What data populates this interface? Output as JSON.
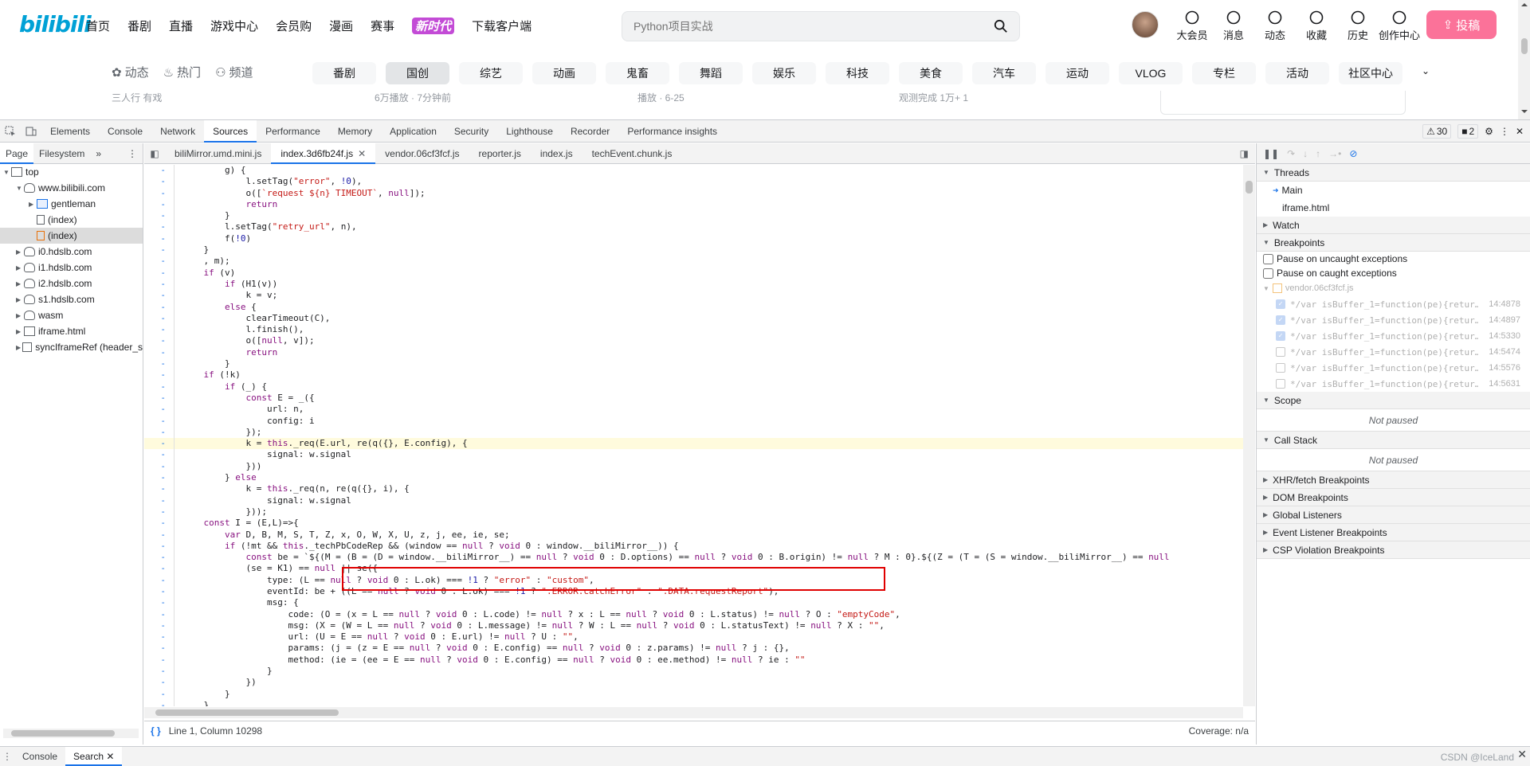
{
  "site": {
    "logo": "bilibili",
    "nav": [
      "首页",
      "番剧",
      "直播",
      "游戏中心",
      "会员购",
      "漫画",
      "赛事"
    ],
    "nav_badge": "新时代",
    "download": "下载客户端",
    "search_placeholder": "Python项目实战",
    "right_nav": [
      {
        "label": "大会员",
        "icon": "vip-icon"
      },
      {
        "label": "消息",
        "icon": "message-icon"
      },
      {
        "label": "动态",
        "icon": "dynamic-icon"
      },
      {
        "label": "收藏",
        "icon": "favorite-icon"
      },
      {
        "label": "历史",
        "icon": "history-icon"
      },
      {
        "label": "创作中心",
        "icon": "creator-icon"
      }
    ],
    "upload": "投稿",
    "channel_left": [
      "动态",
      "热门",
      "频道"
    ],
    "channels": [
      "番剧",
      "国创",
      "综艺",
      "动画",
      "鬼畜",
      "舞蹈",
      "娱乐",
      "科技",
      "美食",
      "汽车",
      "运动",
      "VLOG",
      "专栏",
      "活动",
      "社区中心"
    ],
    "active_channel": "国创",
    "peek_texts": [
      "三人行 有戏",
      "6万播放 · 7分钟前",
      "播放 · 6-25",
      "观测完成 1万+ 1"
    ]
  },
  "devtools": {
    "tabs": [
      "Elements",
      "Console",
      "Network",
      "Sources",
      "Performance",
      "Memory",
      "Application",
      "Security",
      "Lighthouse",
      "Recorder",
      "Performance insights"
    ],
    "active_tab": "Sources",
    "warnings": "30",
    "errors": "2",
    "navigator_tabs": [
      "Page",
      "Filesystem"
    ],
    "tree": [
      {
        "label": "top",
        "depth": 0,
        "kind": "frame",
        "open": true
      },
      {
        "label": "www.bilibili.com",
        "depth": 1,
        "kind": "cloud",
        "open": true
      },
      {
        "label": "gentleman",
        "depth": 2,
        "kind": "folder",
        "open": false
      },
      {
        "label": "(index)",
        "depth": 2,
        "kind": "file"
      },
      {
        "label": "(index)",
        "depth": 2,
        "kind": "file-orange",
        "selected": true
      },
      {
        "label": "i0.hdslb.com",
        "depth": 1,
        "kind": "cloud",
        "open": false
      },
      {
        "label": "i1.hdslb.com",
        "depth": 1,
        "kind": "cloud",
        "open": false
      },
      {
        "label": "i2.hdslb.com",
        "depth": 1,
        "kind": "cloud",
        "open": false
      },
      {
        "label": "s1.hdslb.com",
        "depth": 1,
        "kind": "cloud",
        "open": false
      },
      {
        "label": "wasm",
        "depth": 1,
        "kind": "cloud",
        "open": false
      },
      {
        "label": "iframe.html",
        "depth": 1,
        "kind": "frame",
        "open": false
      },
      {
        "label": "syncIframeRef (header_s",
        "depth": 1,
        "kind": "frame",
        "open": false
      }
    ],
    "file_tabs": [
      "biliMirror.umd.mini.js",
      "index.3d6fb24f.js",
      "vendor.06cf3fcf.js",
      "reporter.js",
      "index.js",
      "techEvent.chunk.js"
    ],
    "active_file": "index.3d6fb24f.js",
    "code_lines": [
      "        g) {",
      "            l.setTag(\"error\", !0),",
      "            o([`request ${n} TIMEOUT`, null]);",
      "            return",
      "        }",
      "        l.setTag(\"retry_url\", n),",
      "        f(!0)",
      "    }",
      "    , m);",
      "    if (v)",
      "        if (H1(v))",
      "            k = v;",
      "        else {",
      "            clearTimeout(C),",
      "            l.finish(),",
      "            o([null, v]);",
      "            return",
      "        }",
      "    if (!k)",
      "        if (_) {",
      "            const E = _({",
      "                url: n,",
      "                config: i",
      "            });",
      "            k = this._req(E.url, re(q({}, E.config), {",
      "                signal: w.signal",
      "            }))",
      "        } else",
      "            k = this._req(n, re(q({}, i), {",
      "                signal: w.signal",
      "            }));",
      "    const I = (E,L)=>{",
      "        var D, B, M, S, T, Z, x, O, W, X, U, z, j, ee, ie, se;",
      "        if (!mt && this._techPbCodeRep && (window == null ? void 0 : window.__biliMirror__)) {",
      "            const be = `${(M = (B = (D = window.__biliMirror__) == null ? void 0 : D.options) == null ? void 0 : B.origin) != null ? M : 0}.${(Z = (T = (S = window.__biliMirror__) == null",
      "            (se = K1) == null || se({",
      "                type: (L == null ? void 0 : L.ok) === !1 ? \"error\" : \"custom\",",
      "                eventId: be + ((L == null ? void 0 : L.ok) === !1 ? \".ERROR.catchError\" : \".DATA.requestReport\"),",
      "                msg: {",
      "                    code: (O = (x = L == null ? void 0 : L.code) != null ? x : L == null ? void 0 : L.status) != null ? O : \"emptyCode\",",
      "                    msg: (X = (W = L == null ? void 0 : L.message) != null ? W : L == null ? void 0 : L.statusText) != null ? X : \"\",",
      "                    url: (U = E == null ? void 0 : E.url) != null ? U : \"\",",
      "                    params: (j = (z = E == null ? void 0 : E.config) == null ? void 0 : z.params) != null ? j : {},",
      "                    method: (ie = (ee = E == null ? void 0 : E.config) == null ? void 0 : ee.method) != null ? ie : \"\"",
      "                }",
      "            })",
      "        }",
      "    }"
    ],
    "highlight_line": 24,
    "status_position": "Line 1, Column 10298",
    "coverage": "Coverage: n/a",
    "debugger": {
      "threads_title": "Threads",
      "threads": [
        "Main",
        "iframe.html"
      ],
      "watch": "Watch",
      "breakpoints": "Breakpoints",
      "pause_uncaught": "Pause on uncaught exceptions",
      "pause_caught": "Pause on caught exceptions",
      "bp_file": "vendor.06cf3fcf.js",
      "bp_items": [
        {
          "code": "*/var isBuffer_1=function(pe){retur…",
          "pos": "14:4878",
          "checked": true
        },
        {
          "code": "*/var isBuffer_1=function(pe){retur…",
          "pos": "14:4897",
          "checked": true
        },
        {
          "code": "*/var isBuffer_1=function(pe){retur…",
          "pos": "14:5330",
          "checked": true
        },
        {
          "code": "*/var isBuffer_1=function(pe){retur…",
          "pos": "14:5474",
          "checked": false
        },
        {
          "code": "*/var isBuffer_1=function(pe){retur…",
          "pos": "14:5576",
          "checked": false
        },
        {
          "code": "*/var isBuffer_1=function(pe){retur…",
          "pos": "14:5631",
          "checked": false
        }
      ],
      "scope": "Scope",
      "not_paused": "Not paused",
      "call_stack": "Call Stack",
      "extra_sections": [
        "XHR/fetch Breakpoints",
        "DOM Breakpoints",
        "Global Listeners",
        "Event Listener Breakpoints",
        "CSP Violation Breakpoints"
      ]
    },
    "drawer_tabs": [
      "Console",
      "Search"
    ],
    "active_drawer": "Search"
  },
  "watermark": "CSDN @IceLand",
  "colors": {
    "accent": "#1a73e8",
    "bili_blue": "#00a1d6",
    "bili_pink": "#fb7299",
    "highlight_box": "#e00000"
  }
}
